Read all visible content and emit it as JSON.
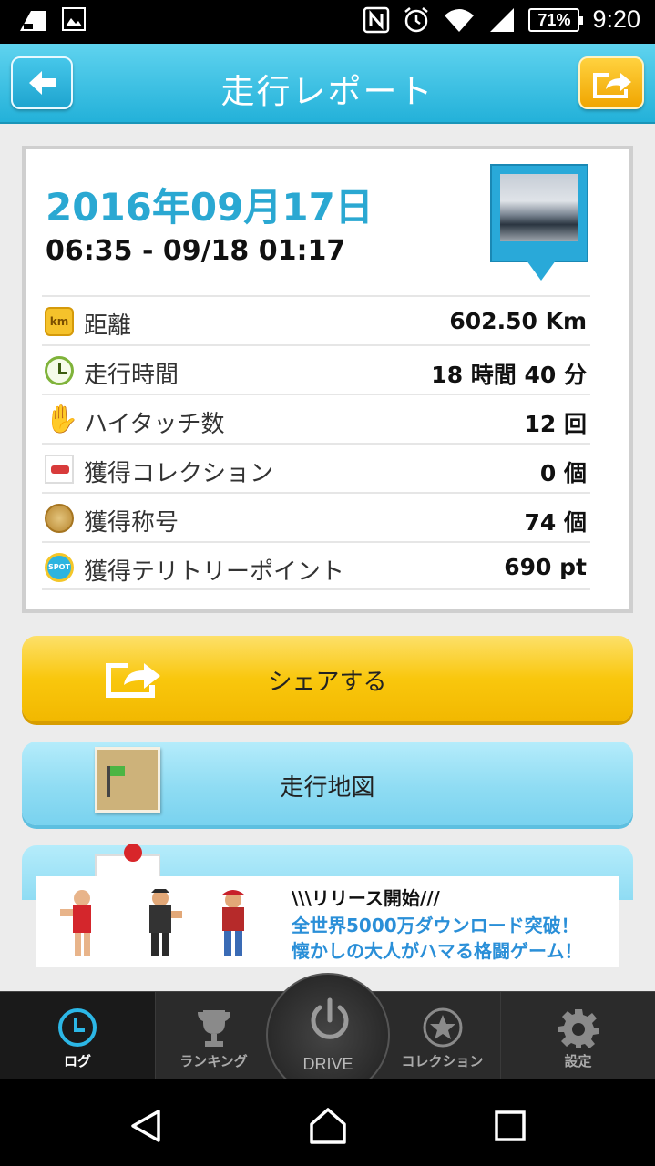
{
  "status_bar": {
    "time": "9:20",
    "battery": "71%",
    "icons": [
      "gallery-icon",
      "image-icon",
      "nfc-icon",
      "alarm-icon",
      "wifi-icon",
      "signal-icon"
    ]
  },
  "header": {
    "title": "走行レポート",
    "back_icon": "arrow-left-icon",
    "share_icon": "share-icon",
    "accent": "#29b1dc"
  },
  "report": {
    "date": "2016年09月17日",
    "time_range": "06:35 - 09/18 01:17",
    "stats": [
      {
        "icon": "km-icon",
        "icon_text": "km",
        "label": "距離",
        "value": "602.50 Km"
      },
      {
        "icon": "clock-icon",
        "label": "走行時間",
        "value": "18 時間 40 分"
      },
      {
        "icon": "hi-touch-icon",
        "label": "ハイタッチ数",
        "value": "12 回"
      },
      {
        "icon": "car-collection-icon",
        "label": "獲得コレクション",
        "value": "0 個"
      },
      {
        "icon": "medal-icon",
        "label": "獲得称号",
        "value": "74 個"
      },
      {
        "icon": "spot-icon",
        "icon_text": "SPOT",
        "label": "獲得テリトリーポイント",
        "value": "690 pt"
      }
    ]
  },
  "actions": {
    "share_label": "シェアする",
    "map_label": "走行地図"
  },
  "ad": {
    "line1": "\\\\\\リリース開始///",
    "line2": "全世界5000万ダウンロード突破！",
    "line3": "懐かしの大人がハマる格闘ゲーム！"
  },
  "tabs": {
    "log": "ログ",
    "ranking": "ランキング",
    "drive": "DRIVE",
    "collection": "コレクション",
    "settings": "設定"
  }
}
